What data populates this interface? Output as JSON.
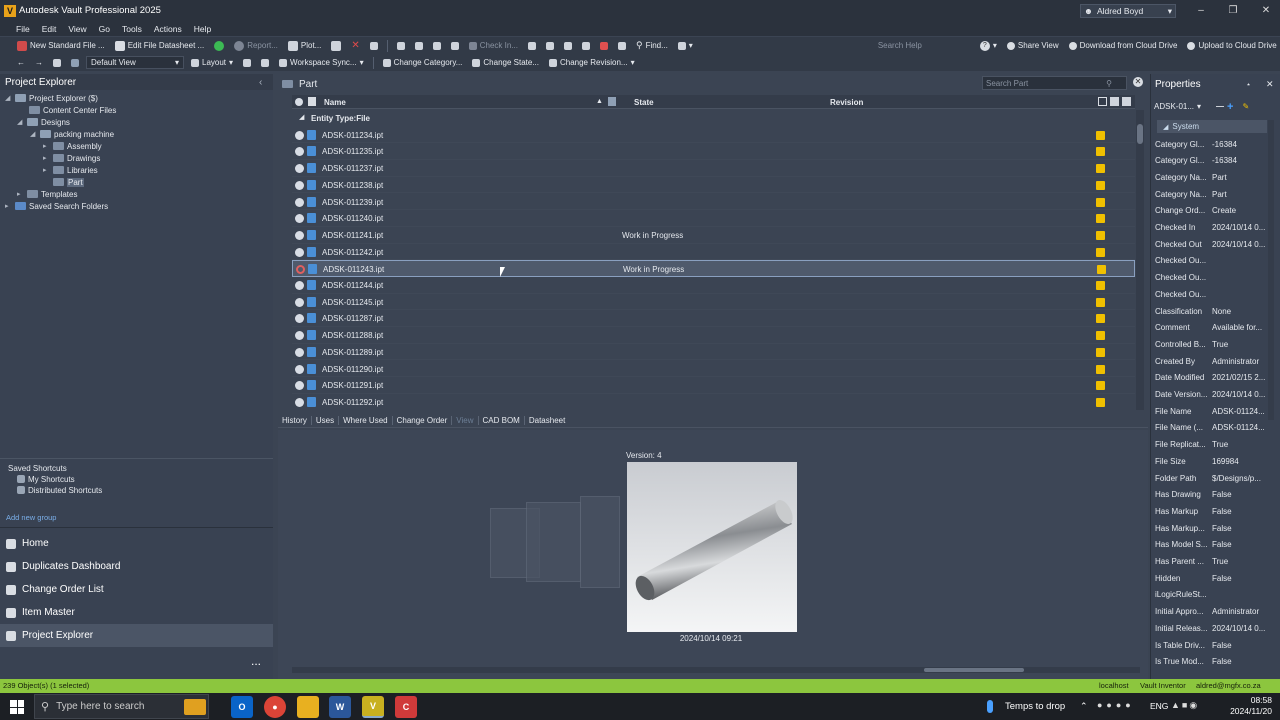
{
  "window": {
    "title": "Autodesk Vault Professional 2025",
    "user": "Aldred Boyd"
  },
  "menu": [
    "File",
    "Edit",
    "View",
    "Go",
    "Tools",
    "Actions",
    "Help"
  ],
  "toolbar1": {
    "new_standard_file": "New Standard File ...",
    "edit_file_datasheet": "Edit File Datasheet ...",
    "report": "Report...",
    "plot": "Plot...",
    "check_in": "Check In...",
    "find": "Find...",
    "search_help": "Search Help",
    "share_view": "Share View",
    "download_cloud": "Download from Cloud Drive",
    "upload_cloud": "Upload to Cloud Drive"
  },
  "toolbar2": {
    "default_view": "Default View",
    "layout": "Layout",
    "workspace_sync": "Workspace Sync...",
    "change_category": "Change Category...",
    "change_state": "Change State...",
    "change_revision": "Change Revision..."
  },
  "left_panel": {
    "title": "Project Explorer",
    "tree": {
      "root": "Project Explorer ($)",
      "content_center": "Content Center Files",
      "designs": "Designs",
      "packing_machine": "packing machine",
      "assembly": "Assembly",
      "drawings": "Drawings",
      "libraries": "Libraries",
      "part": "Part",
      "templates": "Templates",
      "saved_search": "Saved Search Folders"
    },
    "saved_shortcuts": {
      "title": "Saved Shortcuts",
      "my_shortcuts": "My Shortcuts",
      "distributed_shortcuts": "Distributed Shortcuts"
    },
    "add_new_group": "Add new group",
    "nav": [
      "Home",
      "Duplicates Dashboard",
      "Change Order List",
      "Item Master",
      "Project Explorer"
    ],
    "more": "..."
  },
  "main": {
    "breadcrumb": "Part",
    "search_placeholder": "Search Part",
    "columns": {
      "name": "Name",
      "state": "State",
      "revision": "Revision"
    },
    "group_label": "Entity Type:File",
    "rows": [
      {
        "name": "ADSK-011234.ipt",
        "state": ""
      },
      {
        "name": "ADSK-011235.ipt",
        "state": ""
      },
      {
        "name": "ADSK-011237.ipt",
        "state": ""
      },
      {
        "name": "ADSK-011238.ipt",
        "state": ""
      },
      {
        "name": "ADSK-011239.ipt",
        "state": ""
      },
      {
        "name": "ADSK-011240.ipt",
        "state": ""
      },
      {
        "name": "ADSK-011241.ipt",
        "state": "Work in Progress"
      },
      {
        "name": "ADSK-011242.ipt",
        "state": ""
      },
      {
        "name": "ADSK-011243.ipt",
        "state": "Work in Progress"
      },
      {
        "name": "ADSK-011244.ipt",
        "state": ""
      },
      {
        "name": "ADSK-011245.ipt",
        "state": ""
      },
      {
        "name": "ADSK-011287.ipt",
        "state": ""
      },
      {
        "name": "ADSK-011288.ipt",
        "state": ""
      },
      {
        "name": "ADSK-011289.ipt",
        "state": ""
      },
      {
        "name": "ADSK-011290.ipt",
        "state": ""
      },
      {
        "name": "ADSK-011291.ipt",
        "state": ""
      },
      {
        "name": "ADSK-011292.ipt",
        "state": ""
      }
    ],
    "selected_index": 8,
    "tabs": [
      "History",
      "Uses",
      "Where Used",
      "Change Order",
      "View",
      "CAD BOM",
      "Datasheet"
    ],
    "active_tab": "View",
    "preview": {
      "version_label": "Version:  4",
      "date": "2024/10/14 09:21"
    }
  },
  "properties": {
    "title": "Properties",
    "selected": "ADSK-01...",
    "group": "System",
    "rows": [
      {
        "k": "Category Gl...",
        "v": "-16384"
      },
      {
        "k": "Category Gl...",
        "v": "-16384"
      },
      {
        "k": "Category Na...",
        "v": "Part"
      },
      {
        "k": "Category Na...",
        "v": "Part"
      },
      {
        "k": "Change Ord...",
        "v": "Create"
      },
      {
        "k": "Checked In",
        "v": "2024/10/14 0..."
      },
      {
        "k": "Checked Out",
        "v": "2024/10/14 0..."
      },
      {
        "k": "Checked Ou...",
        "v": ""
      },
      {
        "k": "Checked Ou...",
        "v": ""
      },
      {
        "k": "Checked Ou...",
        "v": ""
      },
      {
        "k": "Classification",
        "v": "None"
      },
      {
        "k": "Comment",
        "v": "Available for..."
      },
      {
        "k": "Controlled B...",
        "v": "True"
      },
      {
        "k": "Created By",
        "v": "Administrator"
      },
      {
        "k": "Date Modified",
        "v": "2021/02/15 2..."
      },
      {
        "k": "Date Version...",
        "v": "2024/10/14 0..."
      },
      {
        "k": "File Name",
        "v": "ADSK-01124..."
      },
      {
        "k": "File Name (...",
        "v": "ADSK-01124..."
      },
      {
        "k": "File Replicat...",
        "v": "True"
      },
      {
        "k": "File Size",
        "v": "169984"
      },
      {
        "k": "Folder Path",
        "v": "$/Designs/p..."
      },
      {
        "k": "Has Drawing",
        "v": "False"
      },
      {
        "k": "Has Markup",
        "v": "False"
      },
      {
        "k": "Has Markup...",
        "v": "False"
      },
      {
        "k": "Has Model S...",
        "v": "False"
      },
      {
        "k": "Has Parent ...",
        "v": "True"
      },
      {
        "k": "Hidden",
        "v": "False"
      },
      {
        "k": "iLogicRuleSt...",
        "v": ""
      },
      {
        "k": "Initial Appro...",
        "v": "Administrator"
      },
      {
        "k": "Initial Releas...",
        "v": "2024/10/14 0..."
      },
      {
        "k": "Is Table Driv...",
        "v": "False"
      },
      {
        "k": "Is True Mod...",
        "v": "False"
      }
    ]
  },
  "status": {
    "objects": "239 Object(s) (1 selected)",
    "server": "localhost",
    "vault": "Vault Inventor",
    "email": "aldred@mgfx.co.za"
  },
  "taskbar": {
    "search_placeholder": "Type here to search",
    "weather": "Temps to drop",
    "lang": "ENG",
    "time": "08:58",
    "date": "2024/11/20"
  },
  "colors": {
    "status_bar": "#8cc63e",
    "lifecycle_box": "#f0c000",
    "accent_link": "#7aaee8"
  }
}
